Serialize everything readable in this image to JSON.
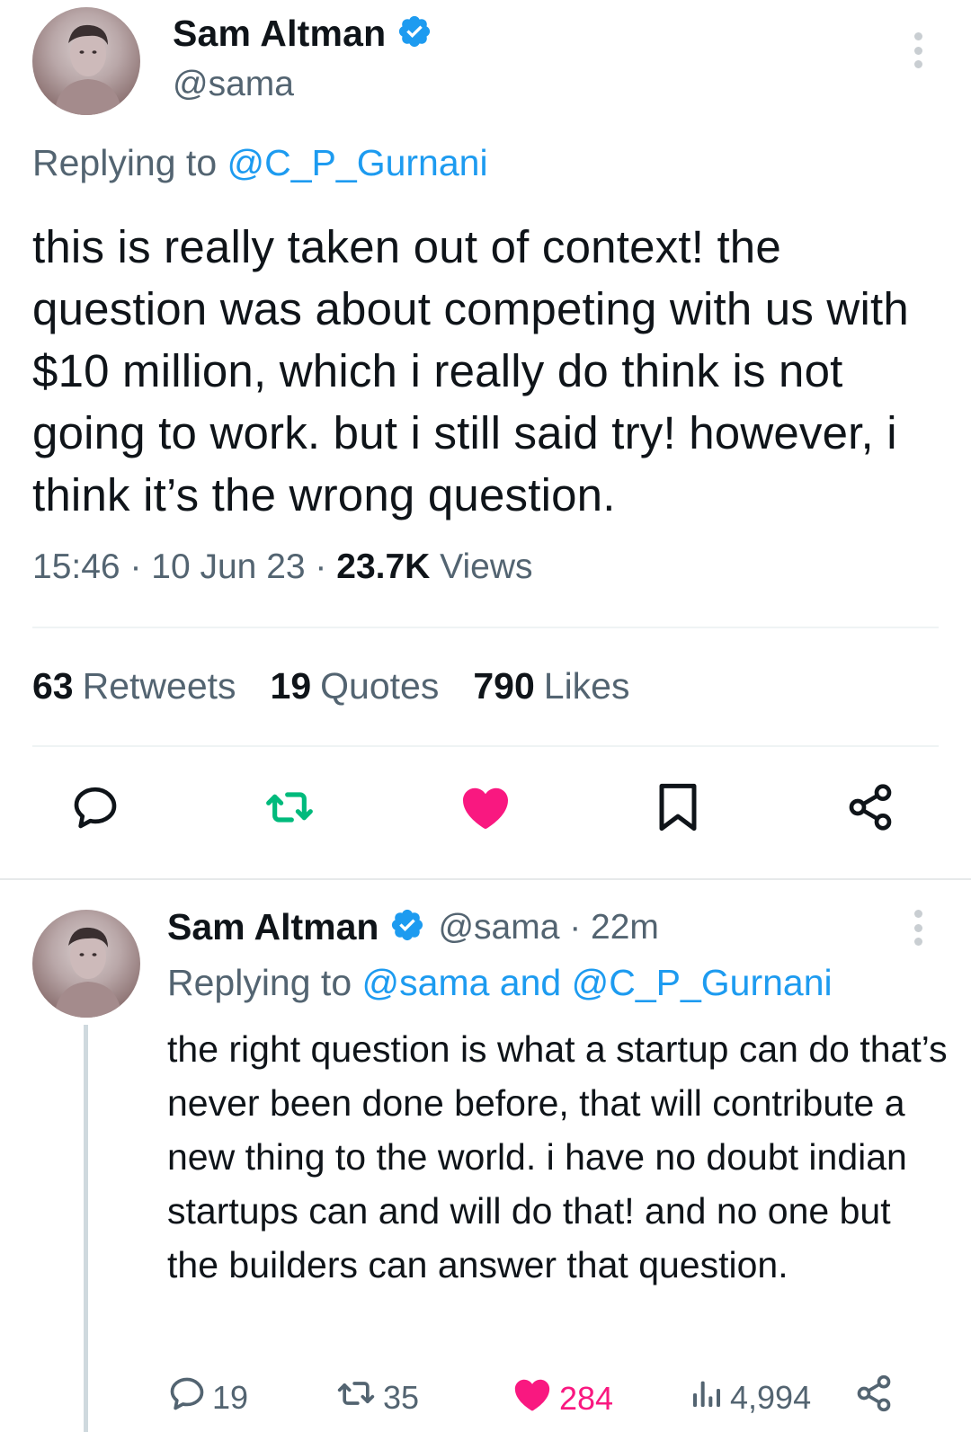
{
  "main_tweet": {
    "author_name": "Sam Altman",
    "handle": "@sama",
    "replying_prefix": "Replying to ",
    "replying_to": "@C_P_Gurnani",
    "text": "this is really taken out of context! the question was about competing with us with $10 million, which i really do think is not going to work. but i still said try! however, i think it’s the wrong question.",
    "time": "15:46",
    "date": "10 Jun 23",
    "separator": " · ",
    "views_count": "23.7K",
    "views_label": " Views",
    "stats": {
      "retweets_count": "63",
      "retweets_label": "Retweets",
      "quotes_count": "19",
      "quotes_label": "Quotes",
      "likes_count": "790",
      "likes_label": "Likes"
    },
    "actions": [
      "reply-icon",
      "retweet-icon",
      "like-icon",
      "bookmark-icon",
      "share-icon"
    ]
  },
  "reply_tweet": {
    "author_name": "Sam Altman",
    "handle": "@sama · 22m",
    "replying_prefix": "Replying to ",
    "replying_to": "@sama and @C_P_Gurnani",
    "text": "the right question is what a startup can do that’s never been done before, that will contribute a new thing to the world. i have no doubt indian startups can and will do that! and no one but the builders can answer that question.",
    "replies": "19",
    "retweets": "35",
    "likes": "284",
    "views": "4,994"
  },
  "colors": {
    "accent": "#1d9bf0",
    "retweet_green": "#00ba7c",
    "like_pink": "#f91880",
    "muted_text": "#536471"
  }
}
